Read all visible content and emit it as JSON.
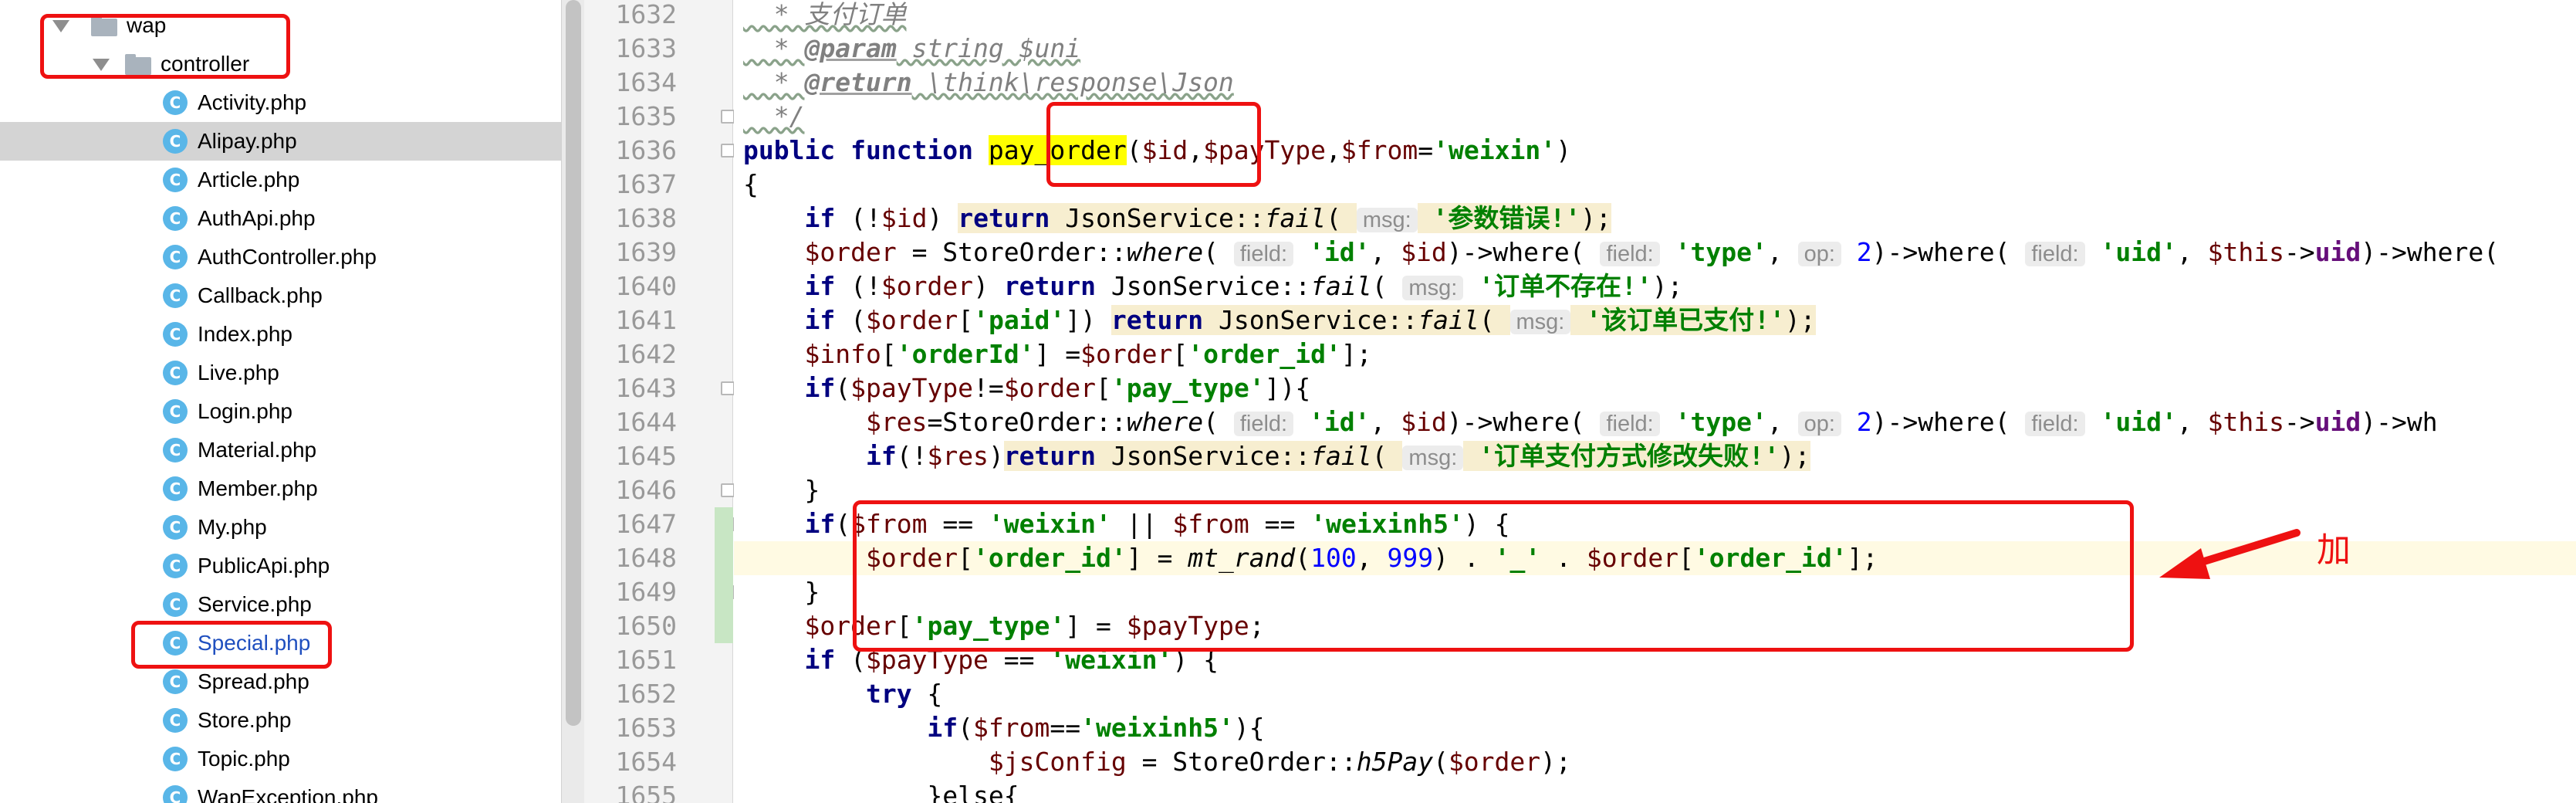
{
  "tree": {
    "items": [
      {
        "label": "wap",
        "type": "folder",
        "arrow": true,
        "selected": false,
        "highlight": false
      },
      {
        "label": "controller",
        "type": "folder",
        "arrow": true,
        "selected": false,
        "highlight": false
      },
      {
        "label": "Activity.php",
        "type": "file",
        "icon": "C",
        "selected": false,
        "highlight": false
      },
      {
        "label": "Alipay.php",
        "type": "file",
        "icon": "C",
        "selected": true,
        "highlight": false
      },
      {
        "label": "Article.php",
        "type": "file",
        "icon": "C",
        "selected": false,
        "highlight": false
      },
      {
        "label": "AuthApi.php",
        "type": "file",
        "icon": "C",
        "selected": false,
        "highlight": false
      },
      {
        "label": "AuthController.php",
        "type": "file",
        "icon": "C",
        "selected": false,
        "highlight": false
      },
      {
        "label": "Callback.php",
        "type": "file",
        "icon": "C",
        "selected": false,
        "highlight": false
      },
      {
        "label": "Index.php",
        "type": "file",
        "icon": "C",
        "selected": false,
        "highlight": false
      },
      {
        "label": "Live.php",
        "type": "file",
        "icon": "C",
        "selected": false,
        "highlight": false
      },
      {
        "label": "Login.php",
        "type": "file",
        "icon": "C",
        "selected": false,
        "highlight": false
      },
      {
        "label": "Material.php",
        "type": "file",
        "icon": "C",
        "selected": false,
        "highlight": false
      },
      {
        "label": "Member.php",
        "type": "file",
        "icon": "C",
        "selected": false,
        "highlight": false
      },
      {
        "label": "My.php",
        "type": "file",
        "icon": "C",
        "selected": false,
        "highlight": false
      },
      {
        "label": "PublicApi.php",
        "type": "file",
        "icon": "C",
        "selected": false,
        "highlight": false
      },
      {
        "label": "Service.php",
        "type": "file",
        "icon": "C",
        "selected": false,
        "highlight": false
      },
      {
        "label": "Special.php",
        "type": "file",
        "icon": "C",
        "selected": false,
        "highlight": true
      },
      {
        "label": "Spread.php",
        "type": "file",
        "icon": "C",
        "selected": false,
        "highlight": false
      },
      {
        "label": "Store.php",
        "type": "file",
        "icon": "C",
        "selected": false,
        "highlight": false
      },
      {
        "label": "Topic.php",
        "type": "file",
        "icon": "C",
        "selected": false,
        "highlight": false
      },
      {
        "label": "WapException.php",
        "type": "file",
        "icon": "C",
        "selected": false,
        "highlight": false
      }
    ]
  },
  "editor": {
    "line_numbers": [
      "1632",
      "1633",
      "1634",
      "1635",
      "1636",
      "1637",
      "1638",
      "1639",
      "1640",
      "1641",
      "1642",
      "1643",
      "1644",
      "1645",
      "1646",
      "1647",
      "1648",
      "1649",
      "1650",
      "1651",
      "1652",
      "1653",
      "1654",
      "1655"
    ],
    "current_line": "1648",
    "lines": [
      [
        {
          "t": "  * 支付订单",
          "c": "cm squig"
        }
      ],
      [
        {
          "t": "  * ",
          "c": "cm squig"
        },
        {
          "t": "@param",
          "c": "cmk"
        },
        {
          "t": " string $uni",
          "c": "cm squig"
        }
      ],
      [
        {
          "t": "  * ",
          "c": "cm squig"
        },
        {
          "t": "@return",
          "c": "cmk"
        },
        {
          "t": " \\think\\response\\Json",
          "c": "cm squig"
        }
      ],
      [
        {
          "t": "  */",
          "c": "cm squig"
        }
      ],
      [
        {
          "t": "public function ",
          "c": "kw"
        },
        {
          "t": "pay_order",
          "c": "fnhl"
        },
        {
          "t": "(",
          "c": ""
        },
        {
          "t": "$id",
          "c": "var"
        },
        {
          "t": ",",
          "c": ""
        },
        {
          "t": "$payType",
          "c": "var"
        },
        {
          "t": ",",
          "c": ""
        },
        {
          "t": "$from",
          "c": "var"
        },
        {
          "t": "=",
          "c": ""
        },
        {
          "t": "'weixin'",
          "c": "str"
        },
        {
          "t": ")",
          "c": ""
        }
      ],
      [
        {
          "t": "{",
          "c": ""
        }
      ],
      [
        {
          "t": "    ",
          "c": ""
        },
        {
          "t": "if",
          "c": "kw"
        },
        {
          "t": " (!",
          "c": ""
        },
        {
          "t": "$id",
          "c": "var"
        },
        {
          "t": ") ",
          "c": ""
        },
        {
          "t": "return",
          "c": "kw warn"
        },
        {
          "t": " JsonService::",
          "c": "warn"
        },
        {
          "t": "fail",
          "c": "it warn"
        },
        {
          "t": "( ",
          "c": "warn"
        },
        {
          "t": "msg:",
          "c": "hint"
        },
        {
          "t": " ",
          "c": "warn"
        },
        {
          "t": "'参数错误!'",
          "c": "str warn"
        },
        {
          "t": ");",
          "c": "warn"
        }
      ],
      [
        {
          "t": "    ",
          "c": ""
        },
        {
          "t": "$order",
          "c": "var"
        },
        {
          "t": " = StoreOrder::",
          "c": ""
        },
        {
          "t": "where",
          "c": "it"
        },
        {
          "t": "( ",
          "c": ""
        },
        {
          "t": "field:",
          "c": "hint"
        },
        {
          "t": " ",
          "c": ""
        },
        {
          "t": "'id'",
          "c": "str"
        },
        {
          "t": ", ",
          "c": ""
        },
        {
          "t": "$id",
          "c": "var"
        },
        {
          "t": ")->where( ",
          "c": ""
        },
        {
          "t": "field:",
          "c": "hint"
        },
        {
          "t": " ",
          "c": ""
        },
        {
          "t": "'type'",
          "c": "str"
        },
        {
          "t": ", ",
          "c": ""
        },
        {
          "t": "op:",
          "c": "hint"
        },
        {
          "t": " ",
          "c": ""
        },
        {
          "t": "2",
          "c": "num"
        },
        {
          "t": ")->where( ",
          "c": ""
        },
        {
          "t": "field:",
          "c": "hint"
        },
        {
          "t": " ",
          "c": ""
        },
        {
          "t": "'uid'",
          "c": "str"
        },
        {
          "t": ", ",
          "c": ""
        },
        {
          "t": "$this",
          "c": "var"
        },
        {
          "t": "->",
          "c": ""
        },
        {
          "t": "uid",
          "c": "fld"
        },
        {
          "t": ")->where(",
          "c": ""
        }
      ],
      [
        {
          "t": "    ",
          "c": ""
        },
        {
          "t": "if",
          "c": "kw"
        },
        {
          "t": " (!",
          "c": ""
        },
        {
          "t": "$order",
          "c": "var"
        },
        {
          "t": ") ",
          "c": ""
        },
        {
          "t": "return",
          "c": "kw"
        },
        {
          "t": " JsonService::",
          "c": ""
        },
        {
          "t": "fail",
          "c": "it"
        },
        {
          "t": "( ",
          "c": ""
        },
        {
          "t": "msg:",
          "c": "hint"
        },
        {
          "t": " ",
          "c": ""
        },
        {
          "t": "'订单不存在!'",
          "c": "str"
        },
        {
          "t": ");",
          "c": ""
        }
      ],
      [
        {
          "t": "    ",
          "c": ""
        },
        {
          "t": "if",
          "c": "kw"
        },
        {
          "t": " (",
          "c": ""
        },
        {
          "t": "$order",
          "c": "var"
        },
        {
          "t": "[",
          "c": ""
        },
        {
          "t": "'paid'",
          "c": "str"
        },
        {
          "t": "]) ",
          "c": ""
        },
        {
          "t": "return",
          "c": "kw warn"
        },
        {
          "t": " JsonService::",
          "c": "warn"
        },
        {
          "t": "fail",
          "c": "it warn"
        },
        {
          "t": "( ",
          "c": "warn"
        },
        {
          "t": "msg:",
          "c": "hint"
        },
        {
          "t": " ",
          "c": "warn"
        },
        {
          "t": "'该订单已支付!'",
          "c": "str warn"
        },
        {
          "t": ");",
          "c": "warn"
        }
      ],
      [
        {
          "t": "    ",
          "c": ""
        },
        {
          "t": "$info",
          "c": "var"
        },
        {
          "t": "[",
          "c": ""
        },
        {
          "t": "'orderId'",
          "c": "str"
        },
        {
          "t": "] =",
          "c": ""
        },
        {
          "t": "$order",
          "c": "var"
        },
        {
          "t": "[",
          "c": ""
        },
        {
          "t": "'order_id'",
          "c": "str"
        },
        {
          "t": "];",
          "c": ""
        }
      ],
      [
        {
          "t": "    ",
          "c": ""
        },
        {
          "t": "if",
          "c": "kw"
        },
        {
          "t": "(",
          "c": ""
        },
        {
          "t": "$payType",
          "c": "var"
        },
        {
          "t": "!=",
          "c": ""
        },
        {
          "t": "$order",
          "c": "var"
        },
        {
          "t": "[",
          "c": ""
        },
        {
          "t": "'pay_type'",
          "c": "str"
        },
        {
          "t": "]){",
          "c": ""
        }
      ],
      [
        {
          "t": "        ",
          "c": ""
        },
        {
          "t": "$res",
          "c": "var"
        },
        {
          "t": "=StoreOrder::",
          "c": ""
        },
        {
          "t": "where",
          "c": "it"
        },
        {
          "t": "( ",
          "c": ""
        },
        {
          "t": "field:",
          "c": "hint"
        },
        {
          "t": " ",
          "c": ""
        },
        {
          "t": "'id'",
          "c": "str"
        },
        {
          "t": ", ",
          "c": ""
        },
        {
          "t": "$id",
          "c": "var"
        },
        {
          "t": ")->where( ",
          "c": ""
        },
        {
          "t": "field:",
          "c": "hint"
        },
        {
          "t": " ",
          "c": ""
        },
        {
          "t": "'type'",
          "c": "str"
        },
        {
          "t": ", ",
          "c": ""
        },
        {
          "t": "op:",
          "c": "hint"
        },
        {
          "t": " ",
          "c": ""
        },
        {
          "t": "2",
          "c": "num"
        },
        {
          "t": ")->where( ",
          "c": ""
        },
        {
          "t": "field:",
          "c": "hint"
        },
        {
          "t": " ",
          "c": ""
        },
        {
          "t": "'uid'",
          "c": "str"
        },
        {
          "t": ", ",
          "c": ""
        },
        {
          "t": "$this",
          "c": "var"
        },
        {
          "t": "->",
          "c": ""
        },
        {
          "t": "uid",
          "c": "fld"
        },
        {
          "t": ")->wh",
          "c": ""
        }
      ],
      [
        {
          "t": "        ",
          "c": ""
        },
        {
          "t": "if",
          "c": "kw"
        },
        {
          "t": "(!",
          "c": ""
        },
        {
          "t": "$res",
          "c": "var"
        },
        {
          "t": ")",
          "c": ""
        },
        {
          "t": "return",
          "c": "kw warn"
        },
        {
          "t": " JsonService::",
          "c": "warn"
        },
        {
          "t": "fail",
          "c": "it warn"
        },
        {
          "t": "( ",
          "c": "warn"
        },
        {
          "t": "msg:",
          "c": "hint"
        },
        {
          "t": " ",
          "c": "warn"
        },
        {
          "t": "'订单支付方式修改失败!'",
          "c": "str warn"
        },
        {
          "t": ");",
          "c": "warn"
        }
      ],
      [
        {
          "t": "    }",
          "c": ""
        }
      ],
      [
        {
          "t": "    ",
          "c": ""
        },
        {
          "t": "if",
          "c": "kw"
        },
        {
          "t": "(",
          "c": ""
        },
        {
          "t": "$from",
          "c": "var"
        },
        {
          "t": " == ",
          "c": ""
        },
        {
          "t": "'weixin'",
          "c": "str"
        },
        {
          "t": " || ",
          "c": ""
        },
        {
          "t": "$from",
          "c": "var"
        },
        {
          "t": " == ",
          "c": ""
        },
        {
          "t": "'weixinh5'",
          "c": "str"
        },
        {
          "t": ") {",
          "c": ""
        }
      ],
      [
        {
          "t": "        ",
          "c": ""
        },
        {
          "t": "$order",
          "c": "var"
        },
        {
          "t": "[",
          "c": ""
        },
        {
          "t": "'order_id'",
          "c": "str"
        },
        {
          "t": "] = ",
          "c": ""
        },
        {
          "t": "mt_rand",
          "c": "it"
        },
        {
          "t": "(",
          "c": ""
        },
        {
          "t": "100",
          "c": "num"
        },
        {
          "t": ", ",
          "c": ""
        },
        {
          "t": "999",
          "c": "num"
        },
        {
          "t": ") . ",
          "c": ""
        },
        {
          "t": "'_'",
          "c": "str"
        },
        {
          "t": " . ",
          "c": ""
        },
        {
          "t": "$order",
          "c": "var"
        },
        {
          "t": "[",
          "c": ""
        },
        {
          "t": "'order_id'",
          "c": "str"
        },
        {
          "t": "];",
          "c": ""
        }
      ],
      [
        {
          "t": "    }",
          "c": ""
        }
      ],
      [
        {
          "t": "    ",
          "c": ""
        },
        {
          "t": "$order",
          "c": "var"
        },
        {
          "t": "[",
          "c": ""
        },
        {
          "t": "'pay_type'",
          "c": "str"
        },
        {
          "t": "] = ",
          "c": ""
        },
        {
          "t": "$payType",
          "c": "var"
        },
        {
          "t": ";",
          "c": ""
        }
      ],
      [
        {
          "t": "    ",
          "c": ""
        },
        {
          "t": "if",
          "c": "kw"
        },
        {
          "t": " (",
          "c": ""
        },
        {
          "t": "$payType",
          "c": "var"
        },
        {
          "t": " == ",
          "c": ""
        },
        {
          "t": "'weixin'",
          "c": "str"
        },
        {
          "t": ") {",
          "c": ""
        }
      ],
      [
        {
          "t": "        ",
          "c": ""
        },
        {
          "t": "try",
          "c": "kw"
        },
        {
          "t": " {",
          "c": ""
        }
      ],
      [
        {
          "t": "            ",
          "c": ""
        },
        {
          "t": "if",
          "c": "kw"
        },
        {
          "t": "(",
          "c": ""
        },
        {
          "t": "$from",
          "c": "var"
        },
        {
          "t": "==",
          "c": ""
        },
        {
          "t": "'weixinh5'",
          "c": "str"
        },
        {
          "t": "){",
          "c": ""
        }
      ],
      [
        {
          "t": "                ",
          "c": ""
        },
        {
          "t": "$jsConfig",
          "c": "var"
        },
        {
          "t": " = StoreOrder::",
          "c": ""
        },
        {
          "t": "h5Pay",
          "c": "it"
        },
        {
          "t": "(",
          "c": ""
        },
        {
          "t": "$order",
          "c": "var"
        },
        {
          "t": ");",
          "c": ""
        }
      ],
      [
        {
          "t": "            ",
          "c": ""
        },
        {
          "t": "}else{",
          "c": ""
        }
      ]
    ]
  },
  "annotation": {
    "label": "加",
    "color": "#ee1111"
  },
  "colors": {
    "keyword": "#000080",
    "string": "#008000",
    "variable": "#660000",
    "number": "#0000ff",
    "comment": "#808080",
    "highlight": "#ffff00",
    "selection": "#d4d4d4",
    "file_icon": "#59b6e8"
  }
}
